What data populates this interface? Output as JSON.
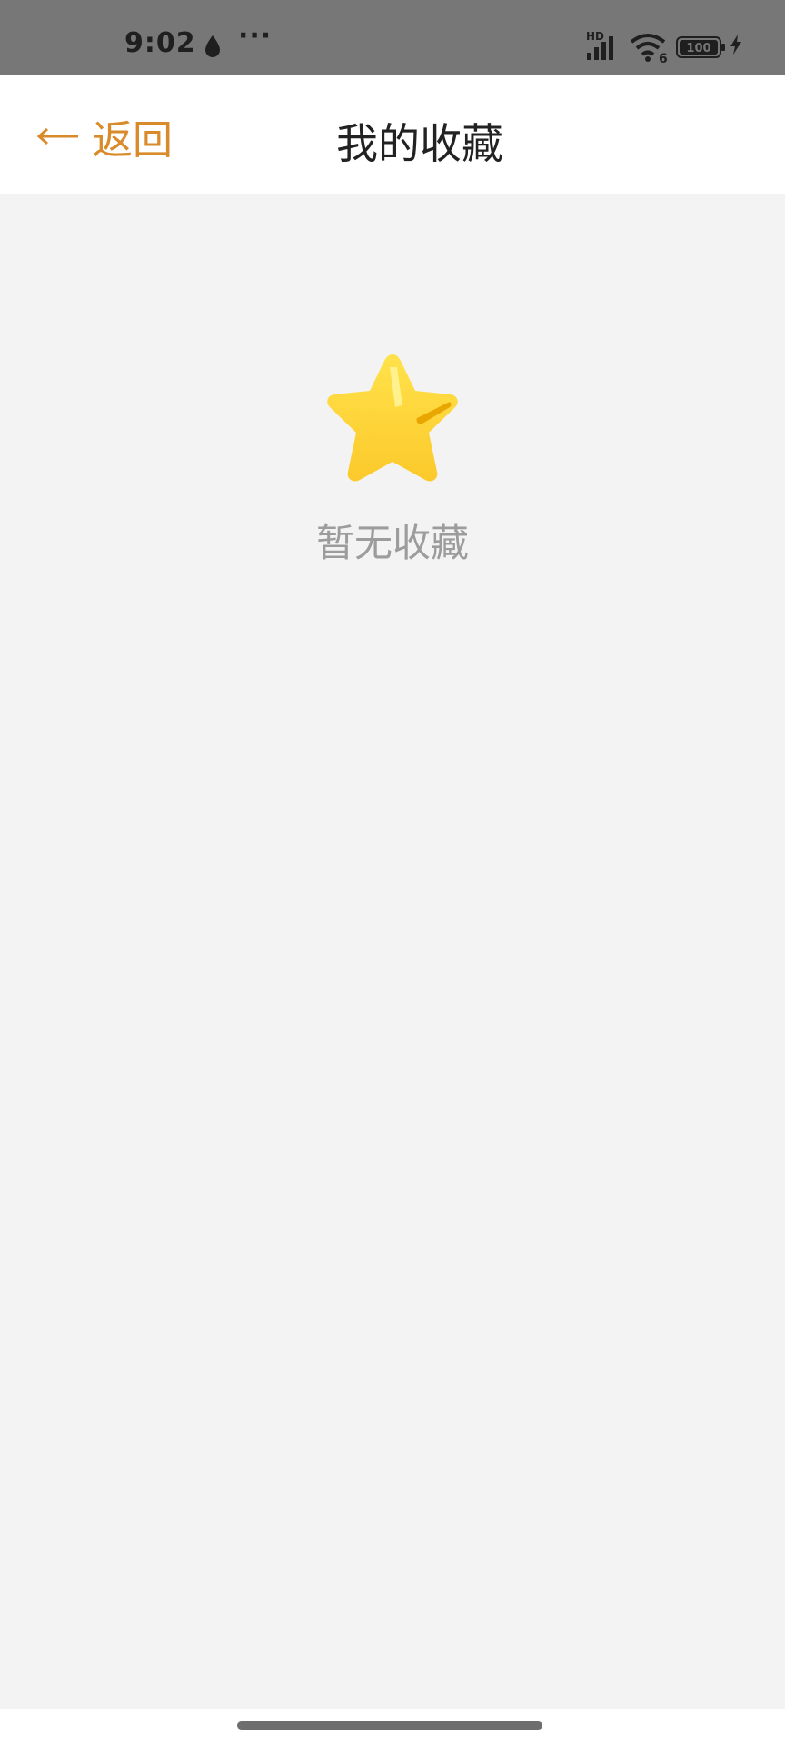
{
  "status_bar": {
    "time": "9:02",
    "notification_dots": "···",
    "network_label": "HD",
    "wifi_label": "6",
    "battery_level": "100"
  },
  "header": {
    "back_label": "返回",
    "title": "我的收藏"
  },
  "empty_state": {
    "icon": "star-icon",
    "message": "暂无收藏"
  },
  "colors": {
    "accent": "#d98b2b",
    "star": "#fdd835",
    "background": "#f3f3f3"
  }
}
